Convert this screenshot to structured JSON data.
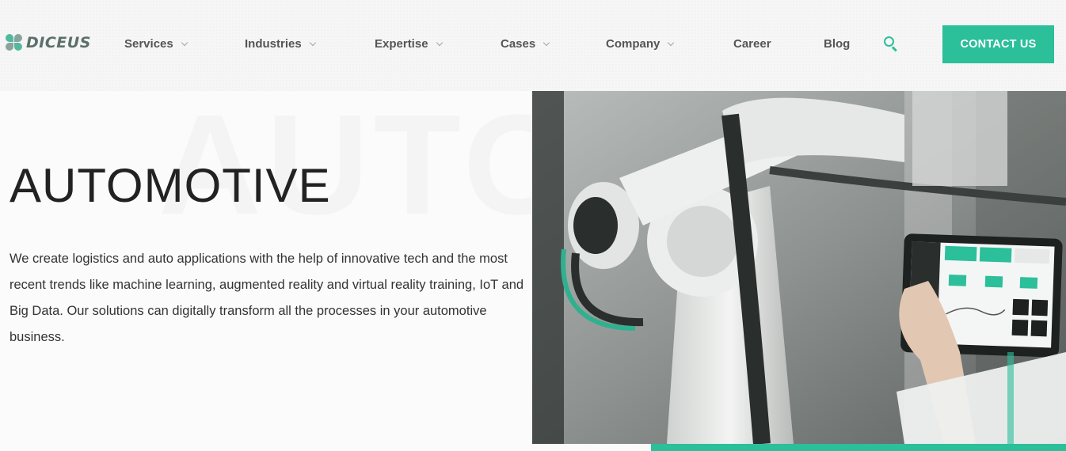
{
  "brand": {
    "logo_text": "DICEUS"
  },
  "nav": {
    "items": [
      {
        "label": "Services",
        "has_dropdown": true
      },
      {
        "label": "Industries",
        "has_dropdown": true
      },
      {
        "label": "Expertise",
        "has_dropdown": true
      },
      {
        "label": "Cases",
        "has_dropdown": true
      },
      {
        "label": "Company",
        "has_dropdown": true
      },
      {
        "label": "Career",
        "has_dropdown": false
      },
      {
        "label": "Blog",
        "has_dropdown": false
      }
    ],
    "search_icon": "search-icon",
    "cta_label": "CONTACT US"
  },
  "hero": {
    "background_word": "AUTO",
    "title": "AUTOMOTIVE",
    "description": "We create logistics and auto applications with the help of innovative tech and the most recent trends like machine learning, augmented reality and virtual reality training, IoT and Big Data. Our solutions can digitally transform all the processes in your automotive business.",
    "image_alt": "robotic arm with tablet dashboard"
  },
  "colors": {
    "accent": "#2bbf9a",
    "text": "#222222",
    "nav_text": "#555555"
  }
}
